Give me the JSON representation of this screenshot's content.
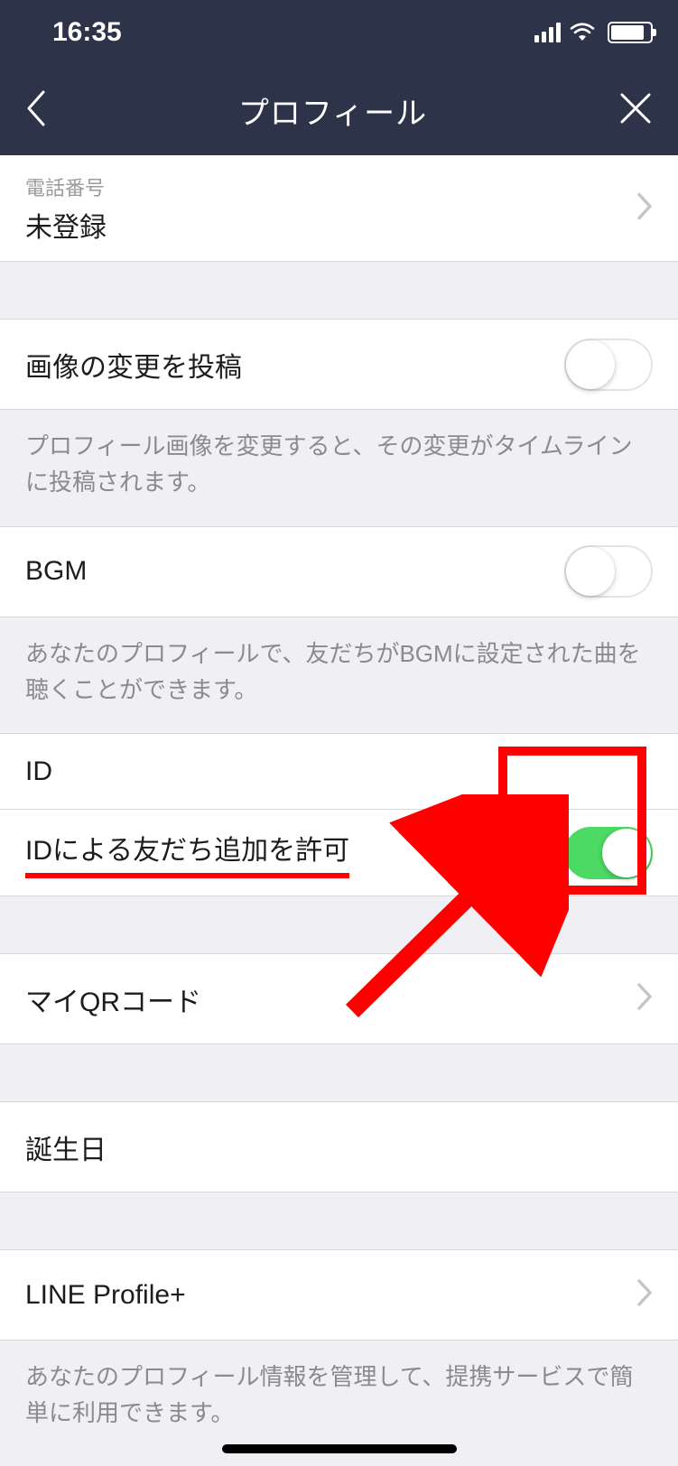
{
  "statusBar": {
    "time": "16:35"
  },
  "nav": {
    "title": "プロフィール"
  },
  "rows": {
    "phone": {
      "label": "電話番号",
      "value": "未登録"
    },
    "postImageChange": {
      "label": "画像の変更を投稿",
      "note": "プロフィール画像を変更すると、その変更がタイムラインに投稿されます。",
      "toggle": false
    },
    "bgm": {
      "label": "BGM",
      "note": "あなたのプロフィールで、友だちがBGMに設定された曲を聴くことができます。",
      "toggle": false
    },
    "id": {
      "label": "ID"
    },
    "idAllow": {
      "label": "IDによる友だち追加を許可",
      "toggle": true
    },
    "qr": {
      "label": "マイQRコード"
    },
    "birthday": {
      "label": "誕生日"
    },
    "profilePlus": {
      "label": "LINE Profile+",
      "note": "あなたのプロフィール情報を管理して、提携サービスで簡単に利用できます。"
    }
  },
  "annotations": {
    "highlightColor": "#ff0000"
  }
}
